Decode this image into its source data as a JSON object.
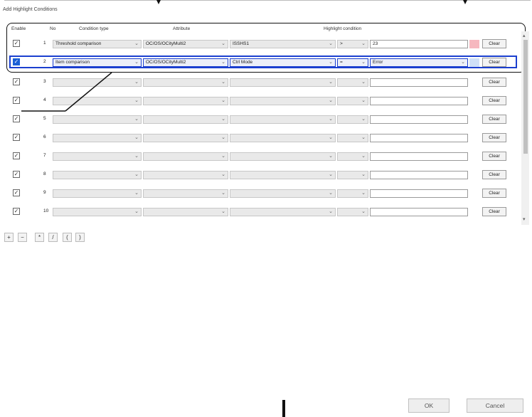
{
  "dialog": {
    "title": "Add Highlight Conditions"
  },
  "headers": {
    "enable": "Enable",
    "no": "No",
    "condition_type": "Condition type",
    "attribute": "Attribute",
    "highlight_condition": "Highlight condition"
  },
  "rows": [
    {
      "no": "1",
      "enabled": true,
      "condition_type": "Threshold comparison",
      "attribute": "OC/OS/OCityMulti2",
      "field": "ISSHS1",
      "operator": "> ",
      "value": "23",
      "swatch": "#f6b8bf",
      "clear": "Clear"
    },
    {
      "no": "2",
      "enabled": true,
      "condition_type": "Item comparison",
      "attribute": "OC/OS/OCityMulti2",
      "field": "Ctrl Mode",
      "operator": "=",
      "value": "Error",
      "swatch": "#cfe0f7",
      "clear": "Clear"
    },
    {
      "no": "3",
      "enabled": true,
      "condition_type": "",
      "attribute": "",
      "field": "",
      "operator": "",
      "value": "",
      "swatch": "",
      "clear": "Clear"
    },
    {
      "no": "4",
      "enabled": true,
      "condition_type": "",
      "attribute": "",
      "field": "",
      "operator": "",
      "value": "",
      "swatch": "",
      "clear": "Clear"
    },
    {
      "no": "5",
      "enabled": true,
      "condition_type": "",
      "attribute": "",
      "field": "",
      "operator": "",
      "value": "",
      "swatch": "",
      "clear": "Clear"
    },
    {
      "no": "6",
      "enabled": true,
      "condition_type": "",
      "attribute": "",
      "field": "",
      "operator": "",
      "value": "",
      "swatch": "",
      "clear": "Clear"
    },
    {
      "no": "7",
      "enabled": true,
      "condition_type": "",
      "attribute": "",
      "field": "",
      "operator": "",
      "value": "",
      "swatch": "",
      "clear": "Clear"
    },
    {
      "no": "8",
      "enabled": true,
      "condition_type": "",
      "attribute": "",
      "field": "",
      "operator": "",
      "value": "",
      "swatch": "",
      "clear": "Clear"
    },
    {
      "no": "9",
      "enabled": true,
      "condition_type": "",
      "attribute": "",
      "field": "",
      "operator": "",
      "value": "",
      "swatch": "",
      "clear": "Clear"
    },
    {
      "no": "10",
      "enabled": true,
      "condition_type": "",
      "attribute": "",
      "field": "",
      "operator": "",
      "value": "",
      "swatch": "",
      "clear": "Clear"
    }
  ],
  "toolbar": {
    "plus": "+",
    "minus": "−",
    "star": "*",
    "slash": "/",
    "open_paren": "(",
    "close_paren": ")"
  },
  "buttons": {
    "ok": "OK",
    "cancel": "Cancel"
  },
  "colors": {
    "selection": "#1b3fcf",
    "checkbox_checked": "#1b5fd6"
  }
}
